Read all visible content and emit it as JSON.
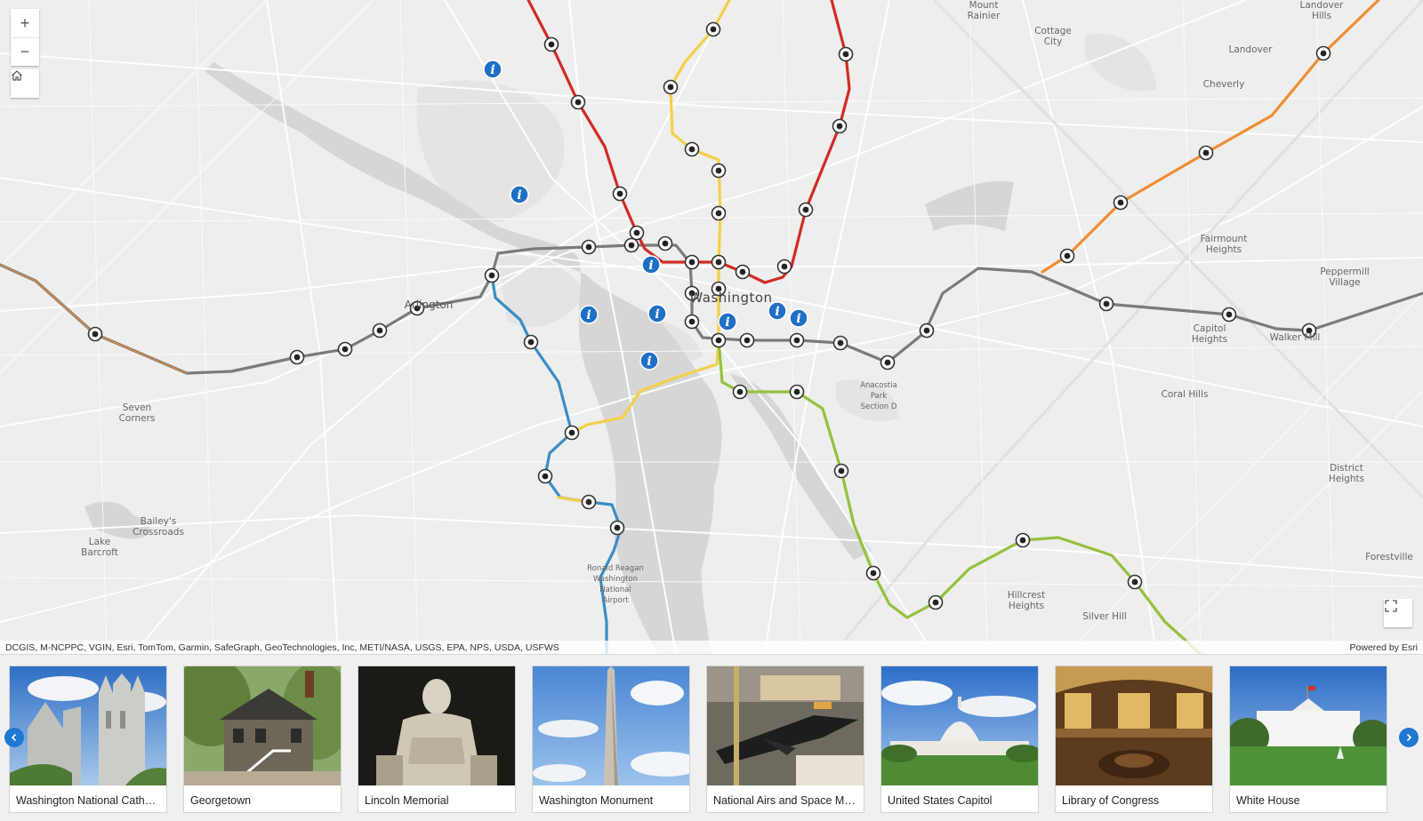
{
  "map": {
    "labels": [
      {
        "text": "Mount\nRainier"
      },
      {
        "text": "Cottage\nCity"
      },
      {
        "text": "Landover\nHills"
      },
      {
        "text": "Landover"
      },
      {
        "text": "Cheverly"
      },
      {
        "text": "Fairmount\nHeights"
      },
      {
        "text": "Peppermill\nVillage"
      },
      {
        "text": "Capitol\nHeights"
      },
      {
        "text": "Walker Mill"
      },
      {
        "text": "Coral Hills"
      },
      {
        "text": "Anacostia\nPark\nSection D"
      },
      {
        "text": "District\nHeights"
      },
      {
        "text": "Forestville"
      },
      {
        "text": "Hillcrest\nHeights"
      },
      {
        "text": "Silver Hill"
      },
      {
        "text": "Seven\nCorners"
      },
      {
        "text": "Bailey's\nCrossroads"
      },
      {
        "text": "Lake\nBarcroft"
      },
      {
        "text": "Ronald Reagan\nWashington\nNational\nAirport"
      }
    ],
    "city_label": "Washington",
    "arlington_label": "Arlington",
    "attribution": "DCGIS, M-NCPPC, VGIN, Esri, TomTom, Garmin, SafeGraph, GeoTechnologies, Inc, METI/NASA, USGS, EPA, NPS, USDA, USFWS",
    "powered_by": "Powered by Esri",
    "colors": {
      "red_line": "#d12b25",
      "yellow_line": "#f2d04a",
      "blue_line": "#3b8dc4",
      "orange_line": "#ef8d34",
      "silver_line": "#7b7b7b",
      "green_line": "#95c13e",
      "info_marker": "#1f6fc5"
    },
    "controls": {
      "zoom_in": "+",
      "zoom_out": "−"
    }
  },
  "gallery": {
    "items": [
      {
        "title": "Washington National Cathedral",
        "display": "Washington National Cathe…"
      },
      {
        "title": "Georgetown",
        "display": "Georgetown"
      },
      {
        "title": "Lincoln Memorial",
        "display": "Lincoln Memorial"
      },
      {
        "title": "Washington Monument",
        "display": "Washington Monument"
      },
      {
        "title": "National Airs and Space Museum",
        "display": "National Airs and Space Mu…"
      },
      {
        "title": "United States Capitol",
        "display": "United States Capitol"
      },
      {
        "title": "Library of Congress",
        "display": "Library of Congress"
      },
      {
        "title": "White House",
        "display": "White House"
      }
    ]
  }
}
